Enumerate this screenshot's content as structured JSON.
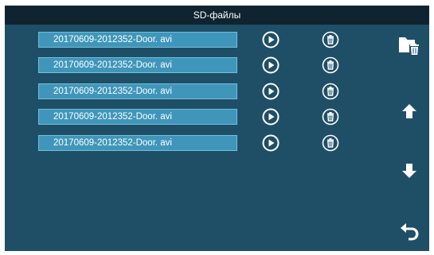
{
  "header": {
    "title": "SD-файлы"
  },
  "files": [
    {
      "name": "20170609-2012352-Door. avi"
    },
    {
      "name": "20170609-2012352-Door. avi"
    },
    {
      "name": "20170609-2012352-Door. avi"
    },
    {
      "name": "20170609-2012352-Door. avi"
    },
    {
      "name": "20170609-2012352-Door. avi"
    }
  ],
  "row_icons": {
    "play": "play-icon",
    "delete": "trash-icon"
  },
  "side_icons": {
    "delete_all": "folder-trash-icon",
    "up": "arrow-up-icon",
    "down": "arrow-down-icon",
    "back": "back-arrow-icon"
  },
  "colors": {
    "background": "#1f4f66",
    "titlebar": "#0f2430",
    "file_bar": "#3f96ba",
    "text": "#ffffff"
  }
}
